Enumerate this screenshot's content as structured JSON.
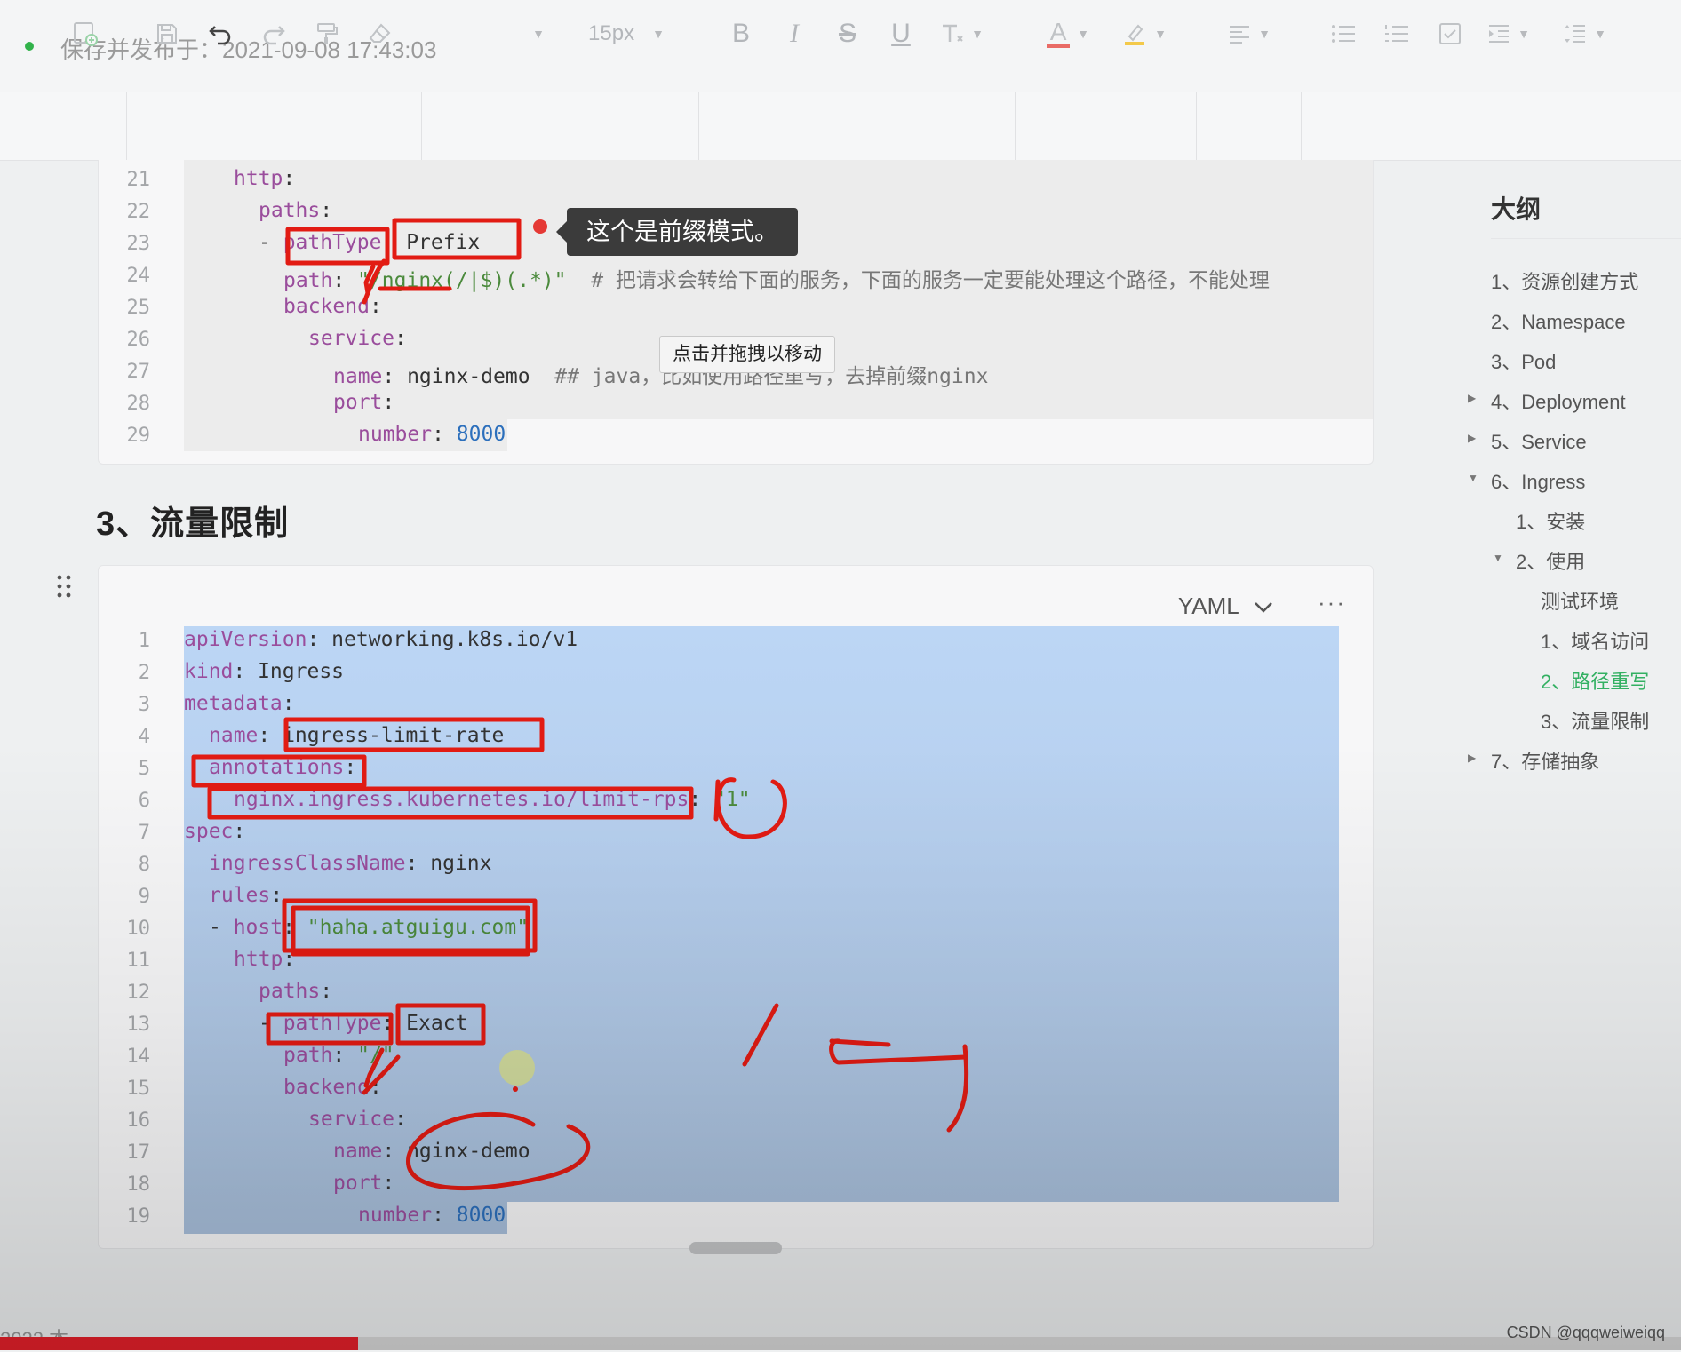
{
  "status": {
    "saved_text": "保存并发布于：2021-09-08 17:43:03",
    "dot_color": "#31b24a"
  },
  "toolbar": {
    "font_size": "15px",
    "tools": [
      "insert-icon",
      "save-icon",
      "undo-icon",
      "redo-icon",
      "format-painter-icon",
      "eraser-icon",
      "font-family-select",
      "font-size-select",
      "bold-icon",
      "italic-icon",
      "strikethrough-icon",
      "underline-icon",
      "clear-format-icon",
      "font-color-icon",
      "highlight-icon",
      "align-icon",
      "bullet-list-icon",
      "numbered-list-icon",
      "checklist-icon",
      "indent-icon",
      "line-spacing-icon"
    ],
    "letters": {
      "bold": "B",
      "italic": "I",
      "strike": "S",
      "underline": "U",
      "font_color": "A"
    }
  },
  "block1": {
    "lines": [
      {
        "no": "21",
        "indent": 2,
        "parts": [
          [
            "k",
            "http"
          ],
          [
            "v",
            ":"
          ]
        ]
      },
      {
        "no": "22",
        "indent": 3,
        "parts": [
          [
            "k",
            "paths"
          ],
          [
            "v",
            ":"
          ]
        ]
      },
      {
        "no": "23",
        "indent": 3,
        "parts": [
          [
            "v",
            "- "
          ],
          [
            "k",
            "pathType"
          ],
          [
            "v",
            ": "
          ],
          [
            "v",
            "Prefix"
          ]
        ]
      },
      {
        "no": "24",
        "indent": 4,
        "parts": [
          [
            "k",
            "path"
          ],
          [
            "v",
            ": "
          ],
          [
            "s",
            "\"/nginx(/|$)(.*)\""
          ],
          [
            "c",
            "  # 把请求会转给下面的服务，下面的服务一定要能处理这个路径，不能处理"
          ]
        ]
      },
      {
        "no": "25",
        "indent": 4,
        "parts": [
          [
            "k",
            "backend"
          ],
          [
            "v",
            ":"
          ]
        ]
      },
      {
        "no": "26",
        "indent": 5,
        "parts": [
          [
            "k",
            "service"
          ],
          [
            "v",
            ":"
          ]
        ]
      },
      {
        "no": "27",
        "indent": 6,
        "parts": [
          [
            "k",
            "name"
          ],
          [
            "v",
            ": nginx-demo  "
          ],
          [
            "c",
            "## java，比如使用路径重写，去掉前缀nginx"
          ]
        ]
      },
      {
        "no": "28",
        "indent": 6,
        "parts": [
          [
            "k",
            "port"
          ],
          [
            "v",
            ":"
          ]
        ]
      },
      {
        "no": "29",
        "indent": 7,
        "parts": [
          [
            "k",
            "number"
          ],
          [
            "v",
            ": "
          ],
          [
            "n",
            "8000"
          ]
        ]
      }
    ]
  },
  "heading": "3、流量限制",
  "block2": {
    "language": "YAML",
    "more": "···",
    "lines": [
      {
        "no": "1",
        "indent": 0,
        "parts": [
          [
            "k",
            "apiVersion"
          ],
          [
            "v",
            ": networking.k8s.io/v1"
          ]
        ]
      },
      {
        "no": "2",
        "indent": 0,
        "parts": [
          [
            "k",
            "kind"
          ],
          [
            "v",
            ": Ingress"
          ]
        ]
      },
      {
        "no": "3",
        "indent": 0,
        "parts": [
          [
            "k",
            "metadata"
          ],
          [
            "v",
            ":"
          ]
        ]
      },
      {
        "no": "4",
        "indent": 1,
        "parts": [
          [
            "k",
            "name"
          ],
          [
            "v",
            ": ingress-limit-rate"
          ]
        ]
      },
      {
        "no": "5",
        "indent": 1,
        "parts": [
          [
            "k",
            "annotations"
          ],
          [
            "v",
            ":"
          ]
        ]
      },
      {
        "no": "6",
        "indent": 2,
        "parts": [
          [
            "k",
            "nginx.ingress.kubernetes.io/limit-rps"
          ],
          [
            "v",
            ": "
          ],
          [
            "s",
            "\"1\""
          ]
        ]
      },
      {
        "no": "7",
        "indent": 0,
        "parts": [
          [
            "k",
            "spec"
          ],
          [
            "v",
            ":"
          ]
        ]
      },
      {
        "no": "8",
        "indent": 1,
        "parts": [
          [
            "k",
            "ingressClassName"
          ],
          [
            "v",
            ": nginx"
          ]
        ]
      },
      {
        "no": "9",
        "indent": 1,
        "parts": [
          [
            "k",
            "rules"
          ],
          [
            "v",
            ":"
          ]
        ]
      },
      {
        "no": "10",
        "indent": 1,
        "parts": [
          [
            "v",
            "- "
          ],
          [
            "k",
            "host"
          ],
          [
            "v",
            ": "
          ],
          [
            "s",
            "\"haha.atguigu.com\""
          ]
        ]
      },
      {
        "no": "11",
        "indent": 2,
        "parts": [
          [
            "k",
            "http"
          ],
          [
            "v",
            ":"
          ]
        ]
      },
      {
        "no": "12",
        "indent": 3,
        "parts": [
          [
            "k",
            "paths"
          ],
          [
            "v",
            ":"
          ]
        ]
      },
      {
        "no": "13",
        "indent": 3,
        "parts": [
          [
            "v",
            "- "
          ],
          [
            "k",
            "pathType"
          ],
          [
            "v",
            ": Exact"
          ]
        ]
      },
      {
        "no": "14",
        "indent": 4,
        "parts": [
          [
            "k",
            "path"
          ],
          [
            "v",
            ": "
          ],
          [
            "s",
            "\"/\""
          ]
        ]
      },
      {
        "no": "15",
        "indent": 4,
        "parts": [
          [
            "k",
            "backend"
          ],
          [
            "v",
            ":"
          ]
        ]
      },
      {
        "no": "16",
        "indent": 5,
        "parts": [
          [
            "k",
            "service"
          ],
          [
            "v",
            ":"
          ]
        ]
      },
      {
        "no": "17",
        "indent": 6,
        "parts": [
          [
            "k",
            "name"
          ],
          [
            "v",
            ": nginx-demo"
          ]
        ]
      },
      {
        "no": "18",
        "indent": 6,
        "parts": [
          [
            "k",
            "port"
          ],
          [
            "v",
            ":"
          ]
        ]
      },
      {
        "no": "19",
        "indent": 7,
        "parts": [
          [
            "k",
            "number"
          ],
          [
            "v",
            ": "
          ],
          [
            "n",
            "8000"
          ]
        ]
      }
    ]
  },
  "tooltips": {
    "prefix_note": "这个是前缀模式。",
    "drag_hint": "点击并拖拽以移动"
  },
  "outline": {
    "title": "大纲",
    "items": [
      {
        "label": "1、资源创建方式",
        "level": 0,
        "arrow": ""
      },
      {
        "label": "2、Namespace",
        "level": 0,
        "arrow": ""
      },
      {
        "label": "3、Pod",
        "level": 0,
        "arrow": ""
      },
      {
        "label": "4、Deployment",
        "level": 0,
        "arrow": "right"
      },
      {
        "label": "5、Service",
        "level": 0,
        "arrow": "right"
      },
      {
        "label": "6、Ingress",
        "level": 0,
        "arrow": "down"
      },
      {
        "label": "1、安装",
        "level": 1,
        "arrow": ""
      },
      {
        "label": "2、使用",
        "level": 1,
        "arrow": "down"
      },
      {
        "label": "测试环境",
        "level": 2,
        "arrow": ""
      },
      {
        "label": "1、域名访问",
        "level": 2,
        "arrow": ""
      },
      {
        "label": "2、路径重写",
        "level": 2,
        "arrow": "",
        "active": true
      },
      {
        "label": "3、流量限制",
        "level": 2,
        "arrow": ""
      },
      {
        "label": "7、存储抽象",
        "level": 0,
        "arrow": "right"
      }
    ],
    "active_color": "#33b062"
  },
  "footer": {
    "year_partial": "2022 本",
    "watermark": "CSDN @qqqweiweiqq",
    "progress": 0.213
  }
}
